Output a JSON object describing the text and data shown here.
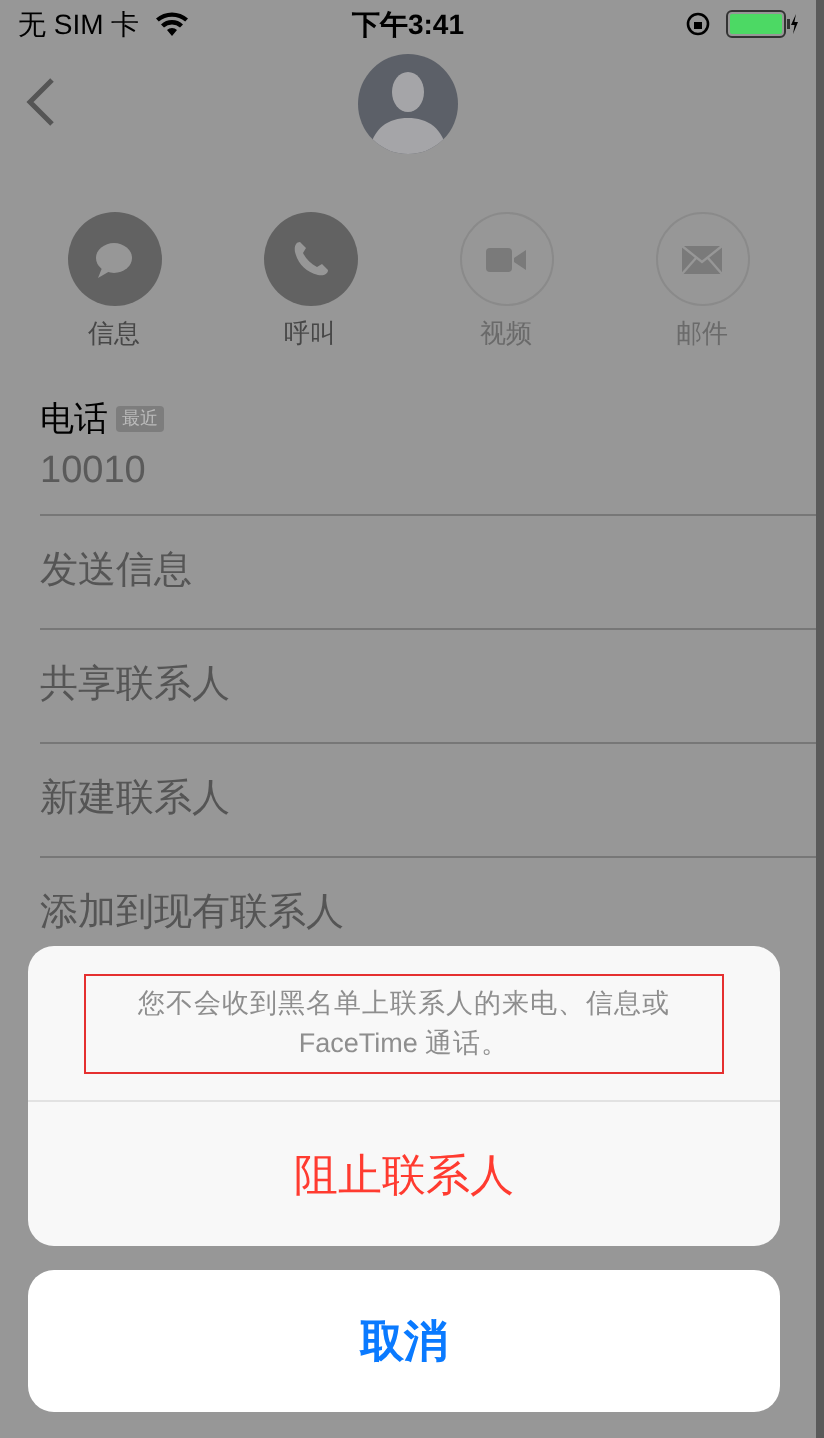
{
  "status_bar": {
    "carrier": "无 SIM 卡",
    "time": "下午3:41"
  },
  "actions": [
    {
      "kind": "message",
      "label": "信息",
      "disabled": false
    },
    {
      "kind": "phone",
      "label": "呼叫",
      "disabled": false
    },
    {
      "kind": "video",
      "label": "视频",
      "disabled": true
    },
    {
      "kind": "mail",
      "label": "邮件",
      "disabled": true
    }
  ],
  "phone": {
    "label": "电话",
    "badge": "最近",
    "number": "10010"
  },
  "rows": [
    "发送信息",
    "共享联系人",
    "新建联系人",
    "添加到现有联系人"
  ],
  "action_sheet": {
    "message": "您不会收到黑名单上联系人的来电、信息或 FaceTime 通话。",
    "message_highlighted": true,
    "destructive_button": "阻止联系人",
    "cancel_button": "取消"
  }
}
